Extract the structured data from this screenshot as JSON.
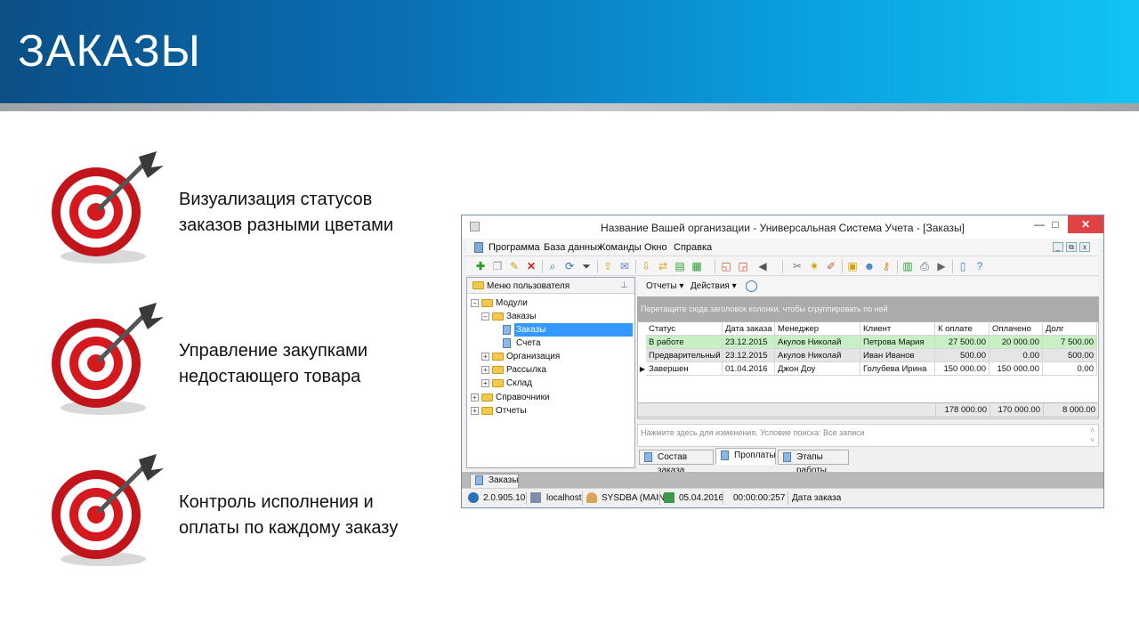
{
  "slide": {
    "title": "ЗАКАЗЫ",
    "bullets": [
      {
        "text": "Визуализация статусов\nзаказов разными цветами"
      },
      {
        "text": "Управление закупками\nнедостающего товара"
      },
      {
        "text": "Контроль исполнения и\nоплаты по каждому заказу"
      }
    ]
  },
  "window": {
    "title": "Название Вашей организации - Универсальная Система Учета - [Заказы]",
    "controls": {
      "minimize": "—",
      "maximize": "□",
      "close": "✕"
    },
    "menu": [
      "Программа",
      "База данных",
      "Команды",
      "Окно",
      "Справка"
    ],
    "mdi_controls": [
      "_",
      "⧉",
      "x"
    ]
  },
  "user_menu": {
    "title": "Меню пользователя",
    "tree": {
      "modules": "Модули",
      "orders_group": "Заказы",
      "orders": "Заказы",
      "invoices": "Счета",
      "organization": "Организация",
      "mailing": "Рассылка",
      "warehouse": "Склад",
      "references": "Справочники",
      "reports": "Отчеты"
    }
  },
  "grid_toolbar": {
    "reports": "Отчеты",
    "actions": "Действия"
  },
  "grid": {
    "group_hint": "Перетащите сюда заголовок колонки, чтобы сгруппировать по ней",
    "columns": [
      "Статус",
      "Дата заказа",
      "Менеджер",
      "Клиент",
      "К оплате",
      "Оплачено",
      "Долг"
    ],
    "rows": [
      [
        "В работе",
        "23.12.2015",
        "Акулов Николай",
        "Петрова Мария",
        "27 500.00",
        "20 000.00",
        "7 500.00"
      ],
      [
        "Предварительный",
        "23.12.2015",
        "Акулов Николай",
        "Иван Иванов",
        "500.00",
        "0.00",
        "500.00"
      ],
      [
        "Завершен",
        "01.04.2016",
        "Джон Доу",
        "Голубева Ирина",
        "150 000.00",
        "150 000.00",
        "0.00"
      ]
    ],
    "row_colors": [
      "#c7f0c4",
      "#e5e5e5",
      "#ffffff"
    ],
    "totals": [
      "178 000.00",
      "170 000.00",
      "8 000.00"
    ],
    "filter_text": "Нажмите здесь для изменения. Условие поиска: Все записи"
  },
  "detail_tabs": [
    "Состав заказа",
    "Проплаты",
    "Этапы работы"
  ],
  "mdi_tab": "Заказы",
  "status": {
    "version": "2.0.905.10",
    "server": "localhost",
    "user": "SYSDBA (MAIN)",
    "date": "05.04.2016",
    "time": "00:00:00:257",
    "field": "Дата заказа"
  },
  "colors": {
    "accent": "#0a7fd0",
    "banner_start": "#0b4f86",
    "banner_end": "#11c4f5",
    "selection": "#3399ff"
  }
}
